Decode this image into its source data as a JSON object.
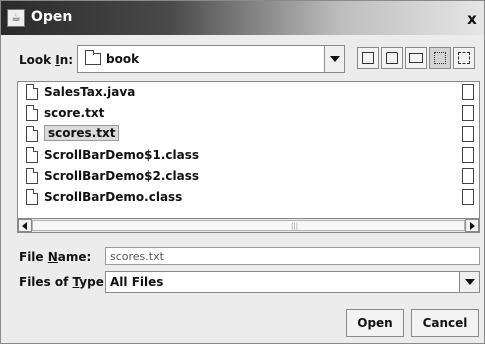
{
  "dialog": {
    "title": "Open",
    "close_glyph": "x",
    "title_icon": "java-cup-icon"
  },
  "look_in": {
    "label_before": "Look ",
    "label_mnemonic": "I",
    "label_after": "n:",
    "value": "book",
    "icon": "folder-icon"
  },
  "toolbar": [
    {
      "name": "up-one-level-button",
      "icon": "up-folder-icon"
    },
    {
      "name": "home-button",
      "icon": "home-icon"
    },
    {
      "name": "new-folder-button",
      "icon": "new-folder-icon"
    },
    {
      "name": "list-view-button",
      "icon": "list-view-icon"
    },
    {
      "name": "details-view-button",
      "icon": "details-view-icon"
    }
  ],
  "files": [
    {
      "name": "SalesTax.java",
      "selected": false
    },
    {
      "name": "score.txt",
      "selected": false
    },
    {
      "name": "scores.txt",
      "selected": true
    },
    {
      "name": "ScrollBarDemo$1.class",
      "selected": false
    },
    {
      "name": "ScrollBarDemo$2.class",
      "selected": false
    },
    {
      "name": "ScrollBarDemo.class",
      "selected": false
    }
  ],
  "file_name": {
    "label_before": "File ",
    "label_mnemonic": "N",
    "label_after": "ame:",
    "value": "scores.txt"
  },
  "files_of_type": {
    "label_before": "Files of ",
    "label_mnemonic": "T",
    "label_after": "ype:",
    "value": "All Files"
  },
  "buttons": {
    "open": "Open",
    "cancel": "Cancel"
  }
}
